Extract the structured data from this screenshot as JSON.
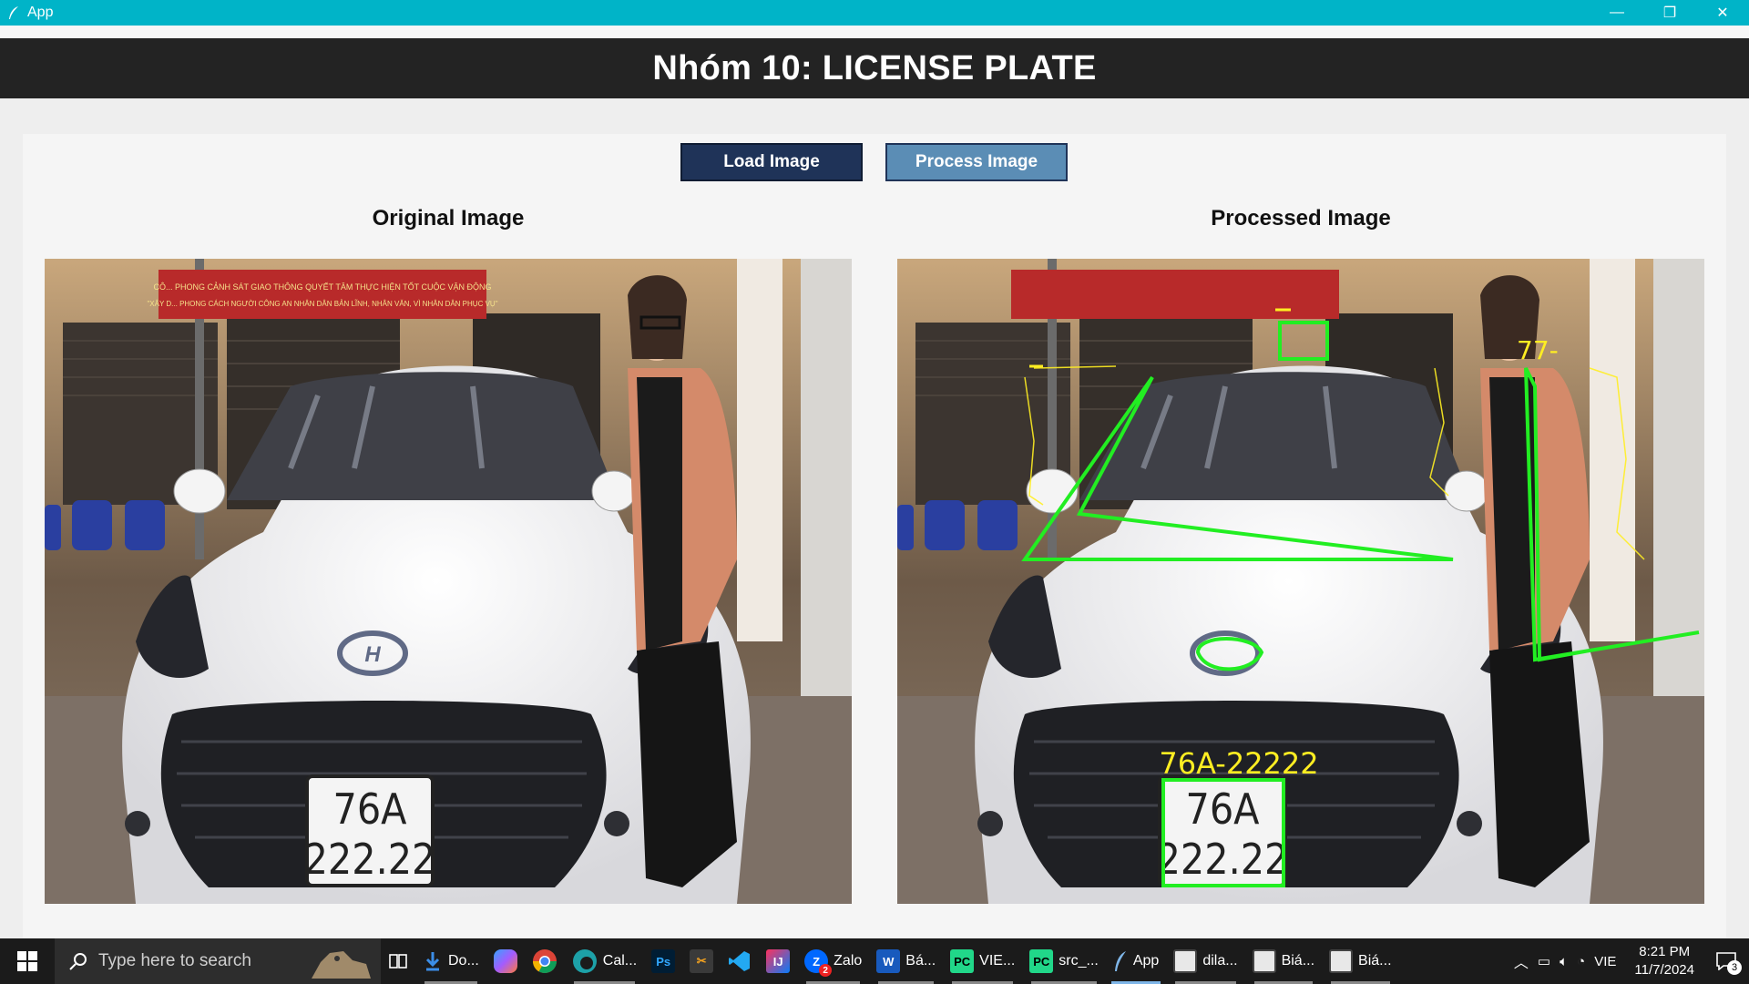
{
  "window": {
    "title": "App",
    "minimize_glyph": "—",
    "maximize_glyph": "❐",
    "close_glyph": "✕"
  },
  "header": {
    "title": "Nhóm 10: LICENSE PLATE"
  },
  "buttons": {
    "load": "Load Image",
    "process": "Process Image"
  },
  "panels": {
    "original": {
      "caption": "Original Image",
      "banner_line1": "CÔ... PHONG CẢNH SÁT GIAO THÔNG QUYẾT TÂM THỰC HIỆN TỐT CUỘC VẬN ĐỘNG",
      "banner_line2": "\"XÂY D... PHONG CÁCH NGƯỜI CÔNG AN NHÂN DÂN BẢN LĨNH, NHÂN VĂN, VÌ NHÂN DÂN PHỤC VỤ\"",
      "plate_line1": "76A",
      "plate_line2": "222.22"
    },
    "processed": {
      "caption": "Processed Image",
      "detected_text": "76A-22222",
      "noise_text": "77-",
      "plate_line1": "76A",
      "plate_line2": "222.22"
    }
  },
  "colors": {
    "titlebar": "#00b4c8",
    "header_bg": "#232323",
    "load_button": "#1f3358",
    "process_button": "#5b8db5",
    "detect_green": "#22ee22",
    "detect_yellow": "#ffee22"
  },
  "taskbar": {
    "search_placeholder": "Type here to search",
    "items": [
      {
        "name": "downloads",
        "label": "Do...",
        "icon": "download-icon"
      },
      {
        "name": "copilot",
        "label": "",
        "icon": "copilot-icon"
      },
      {
        "name": "chrome",
        "label": "",
        "icon": "chrome-icon"
      },
      {
        "name": "edge",
        "label": "Cal...",
        "icon": "edge-icon"
      },
      {
        "name": "photoshop",
        "label": "",
        "icon": "photoshop-icon"
      },
      {
        "name": "snip",
        "label": "",
        "icon": "snip-icon"
      },
      {
        "name": "vscode",
        "label": "",
        "icon": "vscode-icon"
      },
      {
        "name": "intellij",
        "label": "",
        "icon": "intellij-icon"
      },
      {
        "name": "zalo",
        "label": "Zalo",
        "icon": "zalo-icon",
        "badge": "2"
      },
      {
        "name": "word",
        "label": "Bá...",
        "icon": "word-icon"
      },
      {
        "name": "pycharm1",
        "label": "VIE...",
        "icon": "pycharm-icon"
      },
      {
        "name": "pycharm2",
        "label": "src_...",
        "icon": "pycharm-icon"
      },
      {
        "name": "app",
        "label": "App",
        "icon": "feather-icon"
      },
      {
        "name": "win1",
        "label": "dila...",
        "icon": "window-icon"
      },
      {
        "name": "win2",
        "label": "Biá...",
        "icon": "window-icon"
      },
      {
        "name": "win3",
        "label": "Biá...",
        "icon": "window-icon"
      }
    ],
    "tray": {
      "language": "VIE",
      "time": "8:21 PM",
      "date": "11/7/2024",
      "notifications": "3"
    }
  }
}
